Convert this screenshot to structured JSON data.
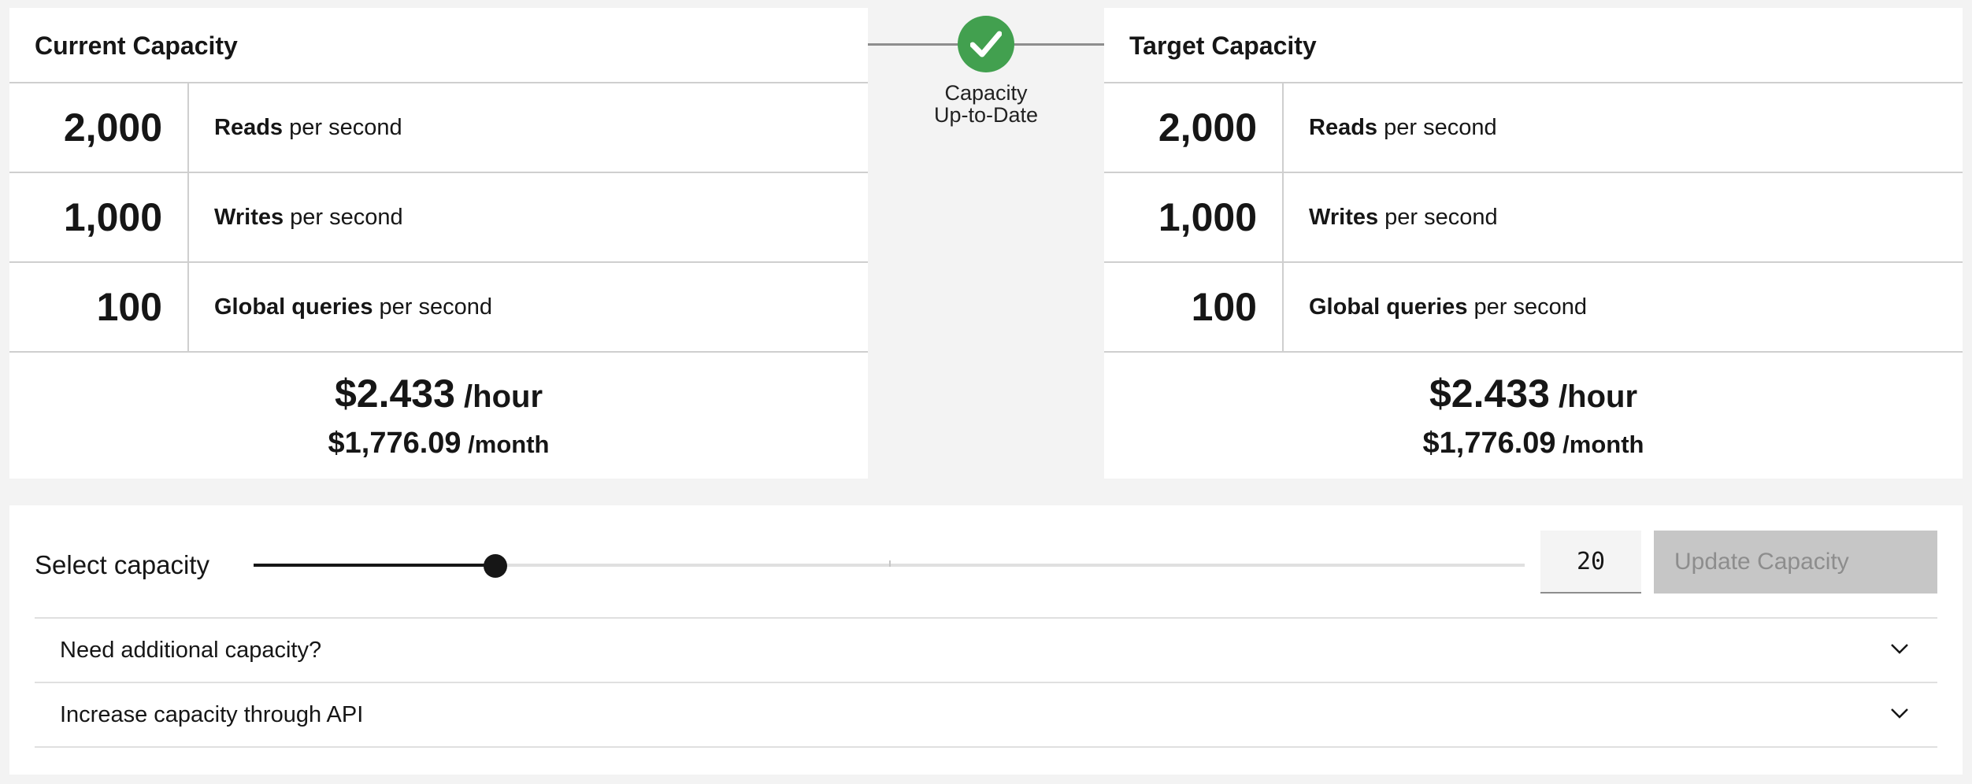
{
  "current": {
    "title": "Current Capacity",
    "metrics": [
      {
        "value": "2,000",
        "label_bold": "Reads",
        "label_rest": " per second"
      },
      {
        "value": "1,000",
        "label_bold": "Writes",
        "label_rest": " per second"
      },
      {
        "value": "100",
        "label_bold": "Global queries",
        "label_rest": " per second"
      }
    ],
    "price_hour": "$2.433",
    "price_hour_unit": " /hour",
    "price_month": "$1,776.09",
    "price_month_unit": " /month"
  },
  "status": {
    "label_line1": "Capacity",
    "label_line2": "Up-to-Date",
    "icon": "checkmark-icon",
    "color": "#42a04f"
  },
  "target": {
    "title": "Target Capacity",
    "metrics": [
      {
        "value": "2,000",
        "label_bold": "Reads",
        "label_rest": " per second"
      },
      {
        "value": "1,000",
        "label_bold": "Writes",
        "label_rest": " per second"
      },
      {
        "value": "100",
        "label_bold": "Global queries",
        "label_rest": " per second"
      }
    ],
    "price_hour": "$2.433",
    "price_hour_unit": " /hour",
    "price_month": "$1,776.09",
    "price_month_unit": " /month"
  },
  "capacity_control": {
    "label": "Select capacity",
    "slider_fraction": 0.19,
    "tick_fraction": 0.5,
    "input_value": "20",
    "update_button": "Update Capacity",
    "update_button_enabled": false
  },
  "accordions": [
    {
      "title": "Need additional capacity?",
      "icon": "chevron-down-icon"
    },
    {
      "title": "Increase capacity through API",
      "icon": "chevron-down-icon"
    }
  ]
}
